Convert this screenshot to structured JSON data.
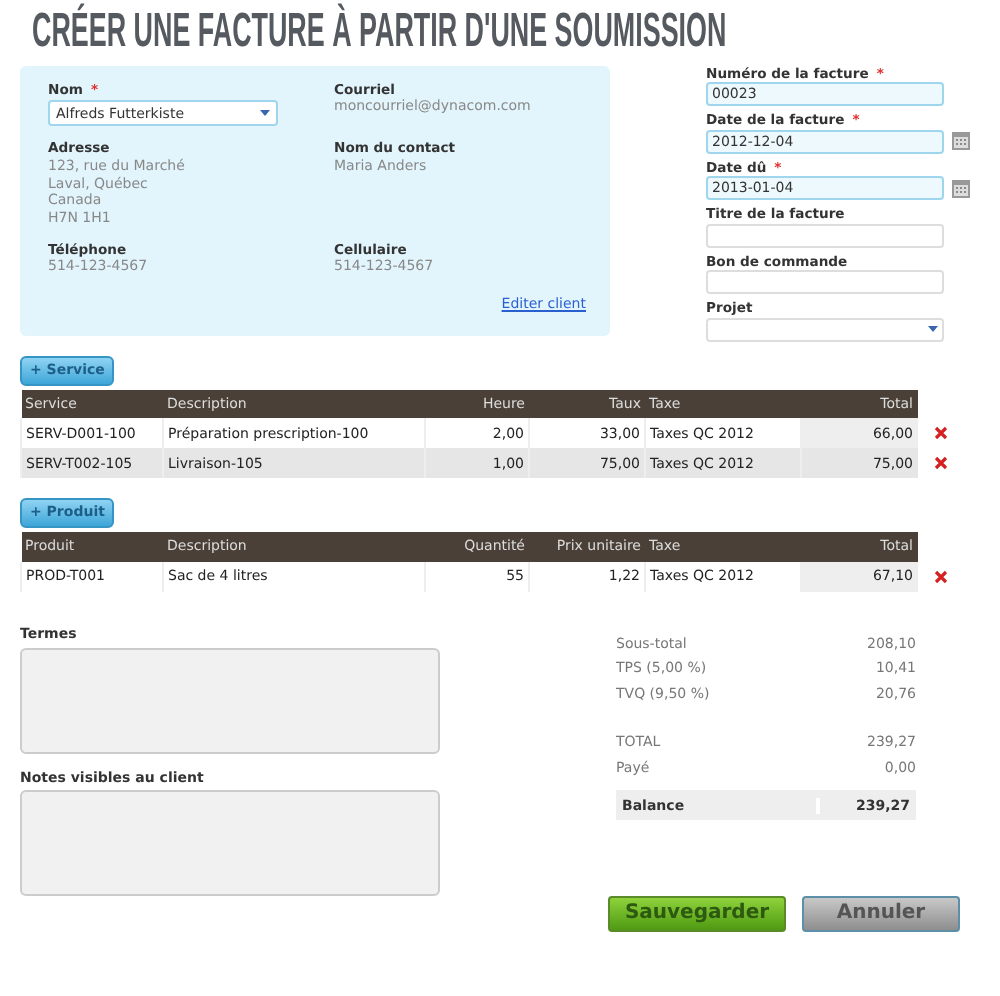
{
  "title": "CRÉER UNE FACTURE À PARTIR D'UNE SOUMISSION",
  "client": {
    "fields": [
      {
        "label": "Nom",
        "required_mark": "*",
        "kind": "select",
        "value": "Alfreds Futterkiste"
      },
      {
        "label": "Courriel",
        "kind": "text",
        "lines": [
          "moncourriel@dynacom.com"
        ]
      },
      {
        "label": "Adresse",
        "kind": "text",
        "lines": [
          "123, rue du Marché",
          "Laval, Québec",
          "Canada",
          "H7N 1H1"
        ]
      },
      {
        "label": "Nom du contact",
        "kind": "text",
        "lines": [
          "Maria Anders"
        ]
      },
      {
        "label": "Téléphone",
        "kind": "text",
        "lines": [
          "514-123-4567"
        ]
      },
      {
        "label": "Cellulaire",
        "kind": "text",
        "lines": [
          "514-123-4567"
        ]
      }
    ],
    "edit_link": "Editer client"
  },
  "invoice_fields": [
    {
      "label": "Numéro de la facture",
      "required_mark": "*",
      "kind": "text",
      "value": "00023"
    },
    {
      "label": "Date de la facture",
      "required_mark": "*",
      "kind": "date",
      "value": "2012-12-04"
    },
    {
      "label": "Date dû",
      "required_mark": "*",
      "kind": "date",
      "value": "2013-01-04"
    },
    {
      "label": "Titre de la facture",
      "kind": "text"
    },
    {
      "label": "Bon de commande",
      "kind": "text"
    },
    {
      "label": "Projet",
      "kind": "select"
    }
  ],
  "tables": [
    {
      "button": "+ Service",
      "columns": [
        "Service",
        "Description",
        "Heure",
        "Taux",
        "Taxe",
        "Total"
      ],
      "rows": [
        [
          "SERV-D001-100",
          "Préparation prescription-100",
          "2,00",
          "33,00",
          "Taxes QC 2012",
          "66,00"
        ],
        [
          "SERV-T002-105",
          "Livraison-105",
          "1,00",
          "75,00",
          "Taxes QC 2012",
          "75,00"
        ]
      ]
    },
    {
      "button": "+ Produit",
      "columns": [
        "Produit",
        "Description",
        "Quantité",
        "Prix unitaire",
        "Taxe",
        "Total"
      ],
      "rows": [
        [
          "PROD-T001",
          "Sac de 4 litres",
          "55",
          "1,22",
          "Taxes QC 2012",
          "67,10"
        ]
      ]
    }
  ],
  "notes": [
    {
      "label": "Termes"
    },
    {
      "label": "Notes visibles au client"
    }
  ],
  "summary": {
    "groups": [
      [
        {
          "label": "Sous-total",
          "value": "208,10"
        },
        {
          "label": "TPS (5,00 %)",
          "value": "10,41"
        },
        {
          "label": "TVQ (9,50 %)",
          "value": "20,76"
        }
      ],
      [
        {
          "label": "TOTAL",
          "value": "239,27"
        },
        {
          "label": "Payé",
          "value": "0,00"
        }
      ]
    ],
    "balance": {
      "label": "Balance",
      "value": "239,27"
    }
  },
  "buttons": [
    {
      "label": "Sauvegarder",
      "kind": "primary"
    },
    {
      "label": "Annuler",
      "kind": "cancel"
    }
  ]
}
